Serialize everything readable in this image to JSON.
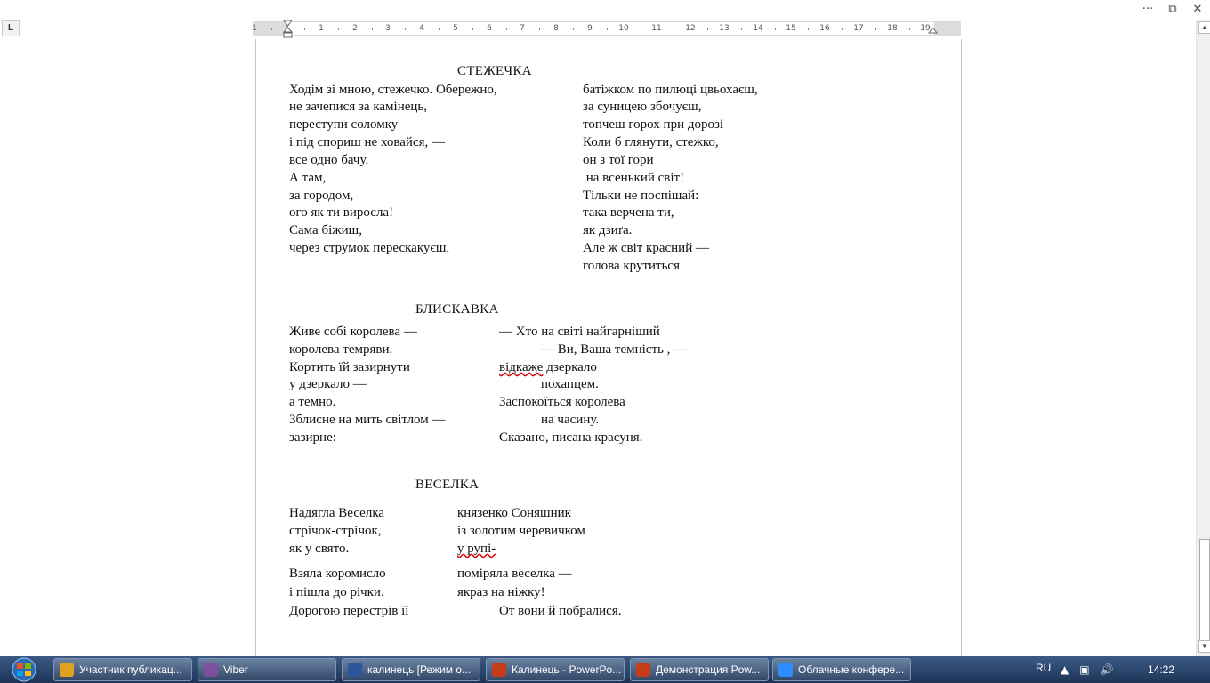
{
  "window": {
    "controls": {
      "more": "···",
      "restore": "⧉",
      "close": "✕"
    }
  },
  "ruler": {
    "tab_selector": "L",
    "numbers": [
      "1",
      "1",
      "1",
      "2",
      "3",
      "4",
      "5",
      "6",
      "7",
      "8",
      "9",
      "10",
      "11",
      "12",
      "13",
      "14",
      "15",
      "16",
      "17",
      "18",
      "19"
    ]
  },
  "poem1": {
    "title": "СТЕЖЕЧКА",
    "left": [
      "Ходім зі мною, стежечко. Обережно,",
      "не зачепися за камінець,",
      "переступи соломку",
      "і під спориш не ховайся, —",
      "все одно бачу.",
      "А там,",
      "за городом,",
      "ого як ти виросла!",
      "Сама біжиш,",
      "через струмок перескакуєш,"
    ],
    "right": [
      "батіжком по пилюці цвьохаєш,",
      "за суницею збочуєш,",
      "топчеш горох при дорозі",
      "Коли б глянути, стежко,",
      "он з тої гори",
      " на всенький світ!",
      "Тільки не поспішай:",
      "така верчена ти,",
      "як дзиґа.",
      "Але ж світ красний —",
      "голова крутиться"
    ]
  },
  "poem2": {
    "title": "БЛИСКАВКА",
    "left": [
      "Живе собі королева —",
      "королева темряви.",
      "Кортить їй зазирнути",
      "у дзеркало —",
      "а темно.",
      "Зблисне на мить світлом —",
      "зазирне:"
    ],
    "right": [
      "— Хто на світі найгарніший",
      "— Ви, Ваша темність , —",
      "відкаже",
      " дзеркало",
      "похапцем.",
      "Заспокоїться королева",
      "на часину.",
      "Сказано, писана красуня."
    ]
  },
  "poem3": {
    "title": "ВЕСЕЛКА",
    "left": [
      "Надягла Веселка",
      "стрічок-стрічок,",
      "як у свято.",
      "Взяла коромисло",
      "і пішла до річки.",
      "Дорогою перестрів її"
    ],
    "right": [
      "князенко Соняшник",
      "із золотим черевичком",
      "у рупі-",
      "поміряла веселка —",
      "якраз на ніжку!",
      "От вони й побралися."
    ]
  },
  "taskbar": {
    "tasks": [
      {
        "label": "Участник публикац...",
        "icon": "chrome-icon",
        "color": "#e0a020"
      },
      {
        "label": "Viber",
        "icon": "viber-icon",
        "color": "#7b519d"
      },
      {
        "label": "калинець [Режим о...",
        "icon": "word-icon",
        "color": "#2b579a"
      },
      {
        "label": "Калинець - PowerPo...",
        "icon": "powerpoint-icon",
        "color": "#c43e1c"
      },
      {
        "label": "Демонстрация Pow...",
        "icon": "powerpoint-show-icon",
        "color": "#c43e1c"
      },
      {
        "label": "Облачные конфере...",
        "icon": "zoom-icon",
        "color": "#2d8cff"
      }
    ],
    "language": "RU",
    "time": "14:22"
  }
}
